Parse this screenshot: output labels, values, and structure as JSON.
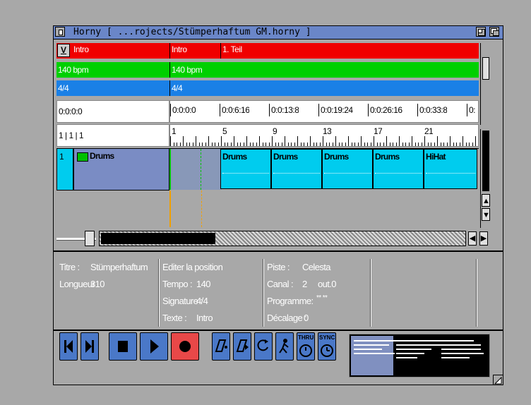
{
  "window": {
    "title": "Horny [ ...rojects/Stümperhaftum GM.horny ]"
  },
  "header_left": {
    "dropdown_label": "V",
    "marker_value": "Intro",
    "tempo_value": "140 bpm",
    "signature_value": "4/4",
    "time_value": "0:0:0:0",
    "bars_value": "1 | 1 | 1"
  },
  "ruler": {
    "marker_labels": [
      "Intro",
      "1. Teil"
    ],
    "tempo_label": "140 bpm",
    "signature_label": "4/4",
    "time_labels": [
      "0:0:0:0",
      "0:0:6:16",
      "0:0:13:8",
      "0:0:19:24",
      "0:0:26:16",
      "0:0:33:8",
      "0:"
    ],
    "bar_labels": [
      "1",
      "5",
      "9",
      "13",
      "17",
      "21"
    ]
  },
  "track": {
    "number": "1",
    "name": "Drums",
    "clips": [
      "Drums",
      "Drums",
      "Drums",
      "Drums",
      "HiHat"
    ]
  },
  "info": {
    "titre_label": "Titre :",
    "titre_value": "Stümperhaftum",
    "longueur_label": "Longueur",
    "longueur_value": "310",
    "edit_heading": "Editer la position",
    "tempo_label": "Tempo :",
    "tempo_value": "140",
    "signature_label": "Signature :",
    "signature_value": "4/4",
    "texte_label": "Texte :",
    "texte_value": "Intro",
    "piste_label": "Piste :",
    "piste_value": "Celesta",
    "canal_label": "Canal :",
    "canal_value": "2",
    "out_value": "out.0",
    "programme_label": "Programme:",
    "programme_value": "** **",
    "decalage_label": "Décalage :",
    "decalage_value": "0"
  },
  "transport": {
    "thru_label": "THRU",
    "sync_label": "SYNC"
  },
  "icons": [
    "depth-gadget-icon",
    "zoom-gadget-icon",
    "close-gadget-icon",
    "rewind-icon",
    "fast-forward-icon",
    "stop-icon",
    "play-icon",
    "record-icon",
    "punch-in-icon",
    "punch-out-icon",
    "loop-icon",
    "metronome-icon",
    "thru-icon",
    "sync-icon",
    "resize-icon"
  ],
  "colors": {
    "marker": "#f00000",
    "tempo": "#00d000",
    "signature": "#1a80e6",
    "clip": "#00ccee",
    "track_name_bg": "#7a8cc4",
    "titlebar": "#6a86c8",
    "transport_button": "#4a78c8",
    "record_button": "#e84848"
  }
}
